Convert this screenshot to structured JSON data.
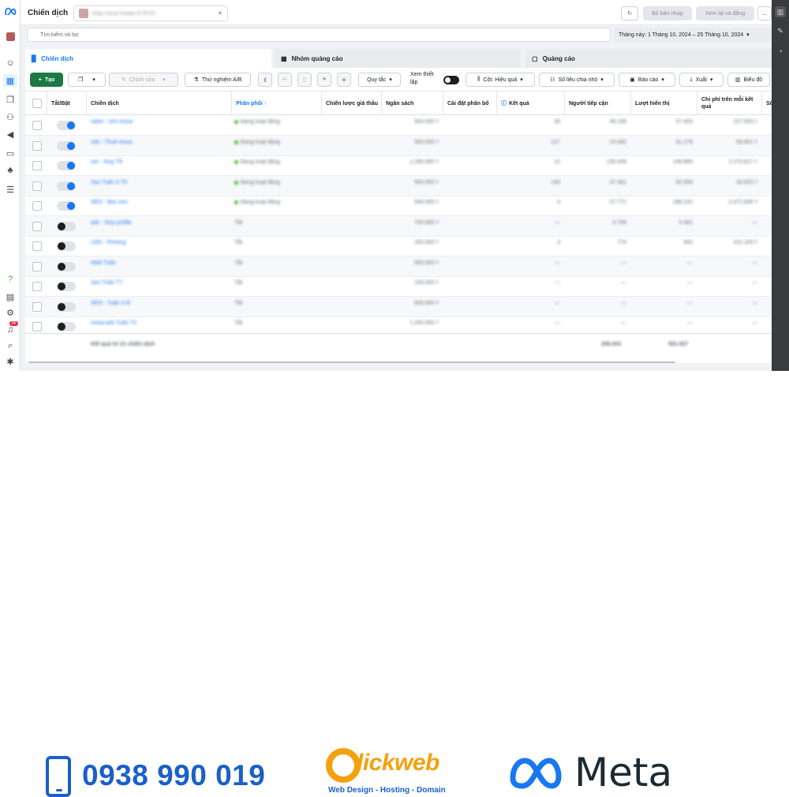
{
  "header": {
    "title": "Chiến dịch",
    "account": "chay moxa media (57872)",
    "draft_button": "Bỏ bản nháp",
    "review_button": "Xem lại và đăng",
    "more_button": "..."
  },
  "search": {
    "placeholder": "Tìm kiếm và lọc"
  },
  "date_range": "Tháng này: 1 Tháng 10, 2024 – 25 Tháng 10, 2024",
  "tabs": [
    {
      "label": "Chiến dịch"
    },
    {
      "label": "Nhóm quảng cáo"
    },
    {
      "label": "Quảng cáo"
    }
  ],
  "toolbar": {
    "create": "Tạo",
    "edit": "Chỉnh sửa",
    "ab_test": "Thử nghiệm A/B",
    "rules": "Quy tắc",
    "preview_setup": "Xem thiết lập",
    "columns": "Cột: Hiệu quả",
    "breakdown": "Số liệu chia nhỏ",
    "reports": "Báo cáo",
    "export": "Xuất",
    "charts": "Biểu đồ"
  },
  "columns": [
    "Tắt/Bật",
    "Chiến dịch",
    "Phân phối ↑",
    "Chiến lược giá thầu",
    "Ngân sách",
    "Cài đặt phân bổ",
    "Kết quả",
    "Người tiếp cận",
    "Lượt hiển thị",
    "Chi phí trên mỗi kết quả",
    "Số ti"
  ],
  "rows": [
    {
      "on": true,
      "name": "video - tinh moxa",
      "delivery": "Đang hoạt động",
      "active": true,
      "budget": "500.000 ₫",
      "results": "36",
      "reach": "46.156",
      "impr": "57.403",
      "cpr": "107.553 ₫"
    },
    {
      "on": true,
      "name": "mkt - Thuê moxa",
      "delivery": "Đang hoạt động",
      "active": true,
      "budget": "500.000 ₫",
      "results": "127",
      "reach": "24.482",
      "impr": "61.278",
      "cpr": "56.601 ₫"
    },
    {
      "on": true,
      "name": "win - thuy T9",
      "delivery": "Đang hoạt động",
      "active": true,
      "budget": "1.200.000 ₫",
      "results": "12",
      "reach": "135.406",
      "impr": "149.865",
      "cpr": "2.273.817 ₫"
    },
    {
      "on": true,
      "name": "Seo Tuấn 4 T9",
      "delivery": "Đang hoạt động",
      "active": true,
      "budget": "500.000 ₫",
      "results": "140",
      "reach": "37.461",
      "impr": "92.956",
      "cpr": "30.923 ₫"
    },
    {
      "on": true,
      "name": "SEO - Bán seo",
      "delivery": "Đang hoạt động",
      "active": true,
      "budget": "500.000 ₫",
      "results": "4",
      "reach": "57.771",
      "impr": "186.242",
      "cpr": "2.472.635 ₫"
    },
    {
      "on": false,
      "name": "ads - thủy profile",
      "delivery": "Tắt",
      "active": false,
      "budget": "700.000 ₫",
      "results": "—",
      "reach": "5.706",
      "impr": "5.481",
      "cpr": "—"
    },
    {
      "on": false,
      "name": "LMS - Printing",
      "delivery": "Tắt",
      "active": false,
      "budget": "200.000 ₫",
      "results": "3",
      "reach": "774",
      "impr": "942",
      "cpr": "101.109 ₫"
    },
    {
      "on": false,
      "name": "Web Tuấn",
      "delivery": "Tắt",
      "active": false,
      "budget": "500.000 ₫",
      "results": "—",
      "reach": "—",
      "impr": "—",
      "cpr": "—"
    },
    {
      "on": false,
      "name": "Seo Tuấn T7",
      "delivery": "Tắt",
      "active": false,
      "budget": "100.000 ₫",
      "results": "—",
      "reach": "—",
      "impr": "—",
      "cpr": "—"
    },
    {
      "on": false,
      "name": "SEO - Tuấn 4 t6",
      "delivery": "Tắt",
      "active": false,
      "budget": "500.000 ₫",
      "results": "—",
      "reach": "—",
      "impr": "—",
      "cpr": "—"
    },
    {
      "on": false,
      "name": "moxa ads Tuấn T5",
      "delivery": "Tắt",
      "active": false,
      "budget": "1.200.000 ₫",
      "results": "—",
      "reach": "—",
      "impr": "—",
      "cpr": "—"
    }
  ],
  "footer": {
    "label": "Kết quả từ 21 chiến dịch",
    "reach": "256.003",
    "impr": "591.507"
  },
  "banner": {
    "phone": "0938 990 019",
    "clickweb": "lickweb",
    "clickweb_sub": "Web Design - Hosting - Domain",
    "meta": "Meta"
  },
  "notifications": "36",
  "colors": {
    "accent": "#1877f2",
    "green": "#1b7a43",
    "brand_blue": "#1b5fc7",
    "brand_orange": "#f2a20d"
  }
}
